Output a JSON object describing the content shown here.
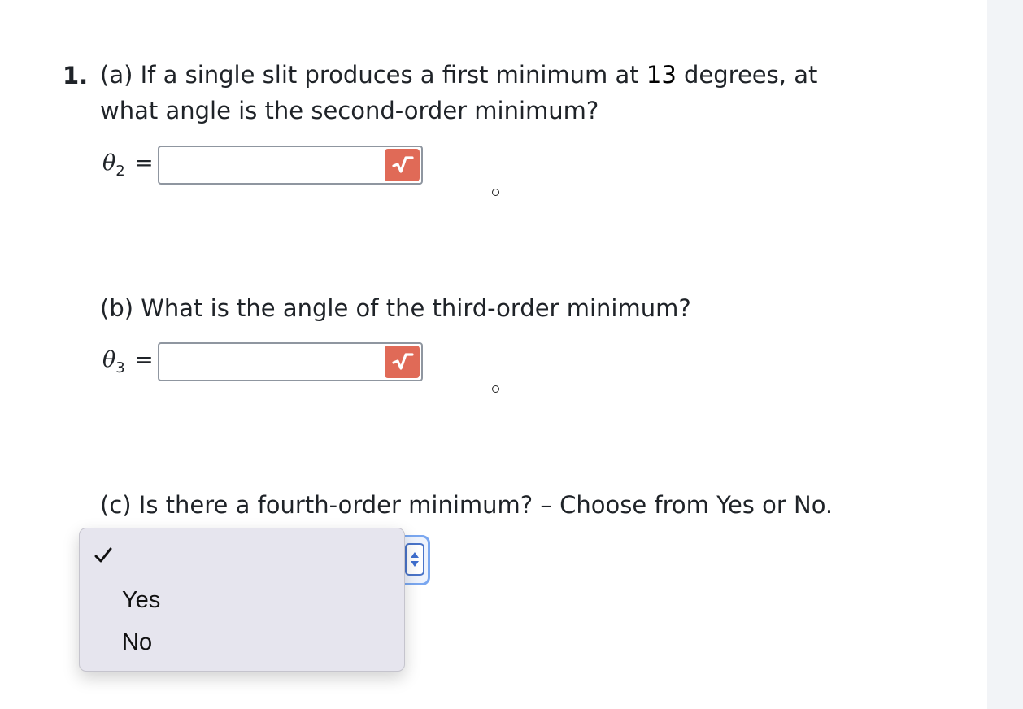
{
  "question": {
    "number": "1.",
    "part_a": {
      "line1_pre": "(a) If a single slit produces a first minimum at ",
      "line1_num": "13",
      "line1_post": " degrees, at",
      "line2": "what angle is the second-order minimum?",
      "symbol": "θ",
      "subscript": "2",
      "equals": "=",
      "input_value": "",
      "unit_symbol": "degree"
    },
    "part_b": {
      "text": "(b) What is the angle of the third-order minimum?",
      "symbol": "θ",
      "subscript": "3",
      "equals": "=",
      "input_value": "",
      "unit_symbol": "degree"
    },
    "part_c": {
      "text": "(c) Is there a fourth-order minimum? – Choose from Yes or No.",
      "selected_value": "",
      "options": [
        "Yes",
        "No"
      ]
    }
  },
  "icons": {
    "math_button": "square-root-icon",
    "checkmark": "checkmark-icon",
    "select_arrows": "up-down-arrows-icon"
  },
  "colors": {
    "math_button_bg": "#e06a57",
    "select_focus_border": "#7aa7f0",
    "dropdown_bg": "#e6e5ee"
  }
}
